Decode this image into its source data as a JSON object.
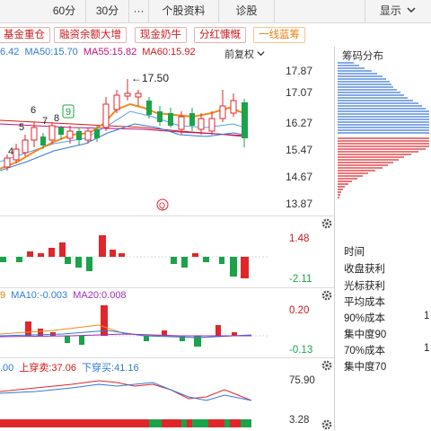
{
  "top_tabs": [
    {
      "label": "60分"
    },
    {
      "label": "30分"
    },
    {
      "label": "···"
    },
    {
      "label": "个股资料"
    },
    {
      "label": "诊股"
    },
    {
      "label": "显示"
    }
  ],
  "tags": [
    {
      "label": "基金重仓"
    },
    {
      "label": "融资余额大增"
    },
    {
      "label": "现金奶牛"
    },
    {
      "label": "分红慷慨"
    },
    {
      "label": "一线蓝筹"
    }
  ],
  "ma_legend": [
    {
      "text": "6.42",
      "color": "#2f7bd8"
    },
    {
      "text": "MA50:15.70",
      "color": "#2f7bd8"
    },
    {
      "text": "MA55:15.82",
      "color": "#c0147a"
    },
    {
      "text": "MA60:15.92",
      "color": "#d0191a"
    }
  ],
  "restore_label": "前复权",
  "price_axis": [
    "17.87",
    "17.07",
    "16.27",
    "15.47",
    "14.67",
    "13.87"
  ],
  "high_annotation": "←17.50",
  "wave_numbers": [
    "4",
    "5",
    "6",
    "7",
    "8",
    "9"
  ],
  "highlight_number": "9",
  "macd_axis": {
    "top": "1.48",
    "bottom": "-2.11"
  },
  "indicator2_legend": [
    {
      "text": "9",
      "color": "#e8820c"
    },
    {
      "text": "MA10:-0.003",
      "color": "#2f7bd8"
    },
    {
      "text": "MA20:0.008",
      "color": "#9b2fbf"
    }
  ],
  "indicator2_axis": {
    "top": "0.20",
    "bottom": "-0.13"
  },
  "indicator3_legend": [
    {
      "text": ".00",
      "color": "#2f7bd8"
    },
    {
      "text": "上穿卖:37.06",
      "color": "#d0191a"
    },
    {
      "text": "下穿买:41.16",
      "color": "#2f7bd8"
    }
  ],
  "indicator3_axis": {
    "top": "75.90",
    "bottom": "3.28"
  },
  "chip_panel": {
    "title": "筹码分布",
    "rows": [
      {
        "label": "时间",
        "value": ""
      },
      {
        "label": "收盘获利",
        "value": ""
      },
      {
        "label": "光标获利",
        "value": ""
      },
      {
        "label": "平均成本",
        "value": ""
      },
      {
        "label": "90%成本",
        "value": "1"
      },
      {
        "label": "集中度90",
        "value": ""
      },
      {
        "label": "70%成本",
        "value": "1"
      },
      {
        "label": "集中度70",
        "value": ""
      }
    ]
  },
  "colors": {
    "up": "#e0262b",
    "down": "#1aa34a",
    "ma_orange": "#f08a1c",
    "ma_blue": "#2f7bd8",
    "chip_blue": "#3a77d4",
    "chip_red": "#e0262b"
  }
}
